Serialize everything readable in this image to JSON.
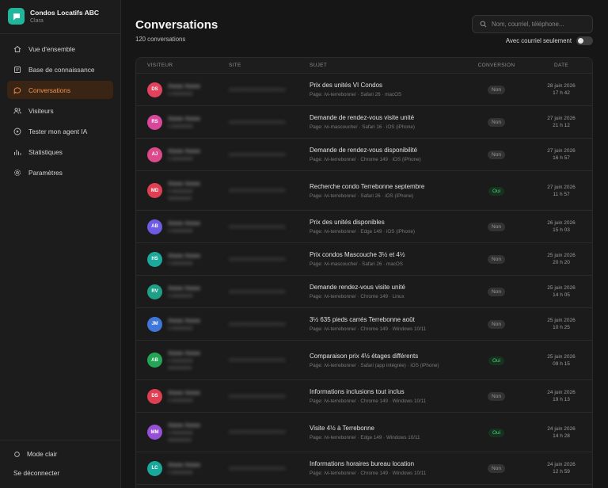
{
  "brand": {
    "name": "Condos Locatifs ABC",
    "user": "Clara",
    "accent": "#1fb79a"
  },
  "nav": [
    {
      "key": "overview",
      "label": "Vue d'ensemble",
      "icon": "home-icon"
    },
    {
      "key": "knowledge",
      "label": "Base de connaissance",
      "icon": "book-icon"
    },
    {
      "key": "conversations",
      "label": "Conversations",
      "icon": "chat-bubble-icon",
      "active": true
    },
    {
      "key": "visitors",
      "label": "Visiteurs",
      "icon": "users-icon"
    },
    {
      "key": "test",
      "label": "Tester mon agent IA",
      "icon": "play-icon"
    },
    {
      "key": "stats",
      "label": "Statistiques",
      "icon": "bar-chart-icon"
    },
    {
      "key": "settings",
      "label": "Paramètres",
      "icon": "gear-icon"
    }
  ],
  "footer": {
    "light_mode": "Mode clair",
    "logout": "Se déconnecter"
  },
  "page": {
    "title": "Conversations",
    "count": "120 conversations"
  },
  "search": {
    "placeholder": "Nom, courriel, téléphone..."
  },
  "filter": {
    "label": "Avec courriel seulement",
    "enabled": false
  },
  "table": {
    "headers": {
      "visitor": "VISITEUR",
      "site": "SITE",
      "subject": "SUJET",
      "conversion": "CONVERSION",
      "date": "DATE"
    },
    "rows": [
      {
        "initials": "DS",
        "color": "#e0435b",
        "subject": "Prix des unités VI Condos",
        "meta": "Page: /vi-terrebonne/ · Safari 26 · macOS",
        "conversion": "Non",
        "date": "28 juin 2026",
        "time": "17 h 42"
      },
      {
        "initials": "RS",
        "color": "#d9479a",
        "subject": "Demande de rendez-vous visite unité",
        "meta": "Page: /vi-mascouche/ · Safari 16 · iOS (iPhone)",
        "conversion": "Non",
        "date": "27 juin 2026",
        "time": "21 h 12"
      },
      {
        "initials": "AJ",
        "color": "#dd4a8c",
        "subject": "Demande de rendez-vous disponibilité",
        "meta": "Page: /vi-terrebonne/ · Chrome 149 · iOS (iPhone)",
        "conversion": "Non",
        "date": "27 juin 2026",
        "time": "16 h 57"
      },
      {
        "initials": "MD",
        "color": "#df3f52",
        "subject": "Recherche condo Terrebonne septembre",
        "meta": "Page: /vi-terrebonne/ · Safari 26 · iOS (iPhone)",
        "conversion": "Oui",
        "date": "27 juin 2026",
        "time": "11 h 57",
        "tall": true
      },
      {
        "initials": "AB",
        "color": "#6d5be3",
        "subject": "Prix des unités disponibles",
        "meta": "Page: /vi-terrebonne/ · Edge 149 · iOS (iPhone)",
        "conversion": "Non",
        "date": "26 juin 2026",
        "time": "15 h 03"
      },
      {
        "initials": "HS",
        "color": "#1ba99c",
        "subject": "Prix condos Mascouche 3½ et 4½",
        "meta": "Page: /vi-mascouche/ · Safari 26 · macOS",
        "conversion": "Non",
        "date": "25 juin 2026",
        "time": "20 h 20"
      },
      {
        "initials": "RV",
        "color": "#1e9f86",
        "subject": "Demande rendez-vous visite unité",
        "meta": "Page: /vi-terrebonne/ · Chrome 149 · Linux",
        "conversion": "Non",
        "date": "25 juin 2026",
        "time": "14 h 05"
      },
      {
        "initials": "JM",
        "color": "#3f76d9",
        "subject": "3½ 635 pieds carrés Terrebonne août",
        "meta": "Page: /vi-terrebonne/ · Chrome 149 · Windows 10/11",
        "conversion": "Non",
        "date": "25 juin 2026",
        "time": "10 h 25"
      },
      {
        "initials": "AB",
        "color": "#23a556",
        "subject": "Comparaison prix 4½ étages différents",
        "meta": "Page: /vi-terrebonne/ · Safari (app intégrée) · iOS (iPhone)",
        "conversion": "Oui",
        "date": "25 juin 2026",
        "time": "09 h 15",
        "tall": true
      },
      {
        "initials": "DS",
        "color": "#df3f52",
        "subject": "Informations inclusions tout inclus",
        "meta": "Page: /vi-terrebonne/ · Chrome 149 · Windows 10/11",
        "conversion": "Non",
        "date": "24 juin 2026",
        "time": "19 h 13"
      },
      {
        "initials": "MM",
        "color": "#9650d6",
        "subject": "Visite 4½ à Terrebonne",
        "meta": "Page: /vi-terrebonne/ · Edge 149 · Windows 10/11",
        "conversion": "Oui",
        "date": "24 juin 2026",
        "time": "14 h 28",
        "tall": true
      },
      {
        "initials": "LC",
        "color": "#1aa89a",
        "subject": "Informations horaires bureau location",
        "meta": "Page: /vi-terrebonne/ · Chrome 149 · Windows 10/11",
        "conversion": "Non",
        "date": "24 juin 2026",
        "time": "12 h 59"
      }
    ]
  }
}
